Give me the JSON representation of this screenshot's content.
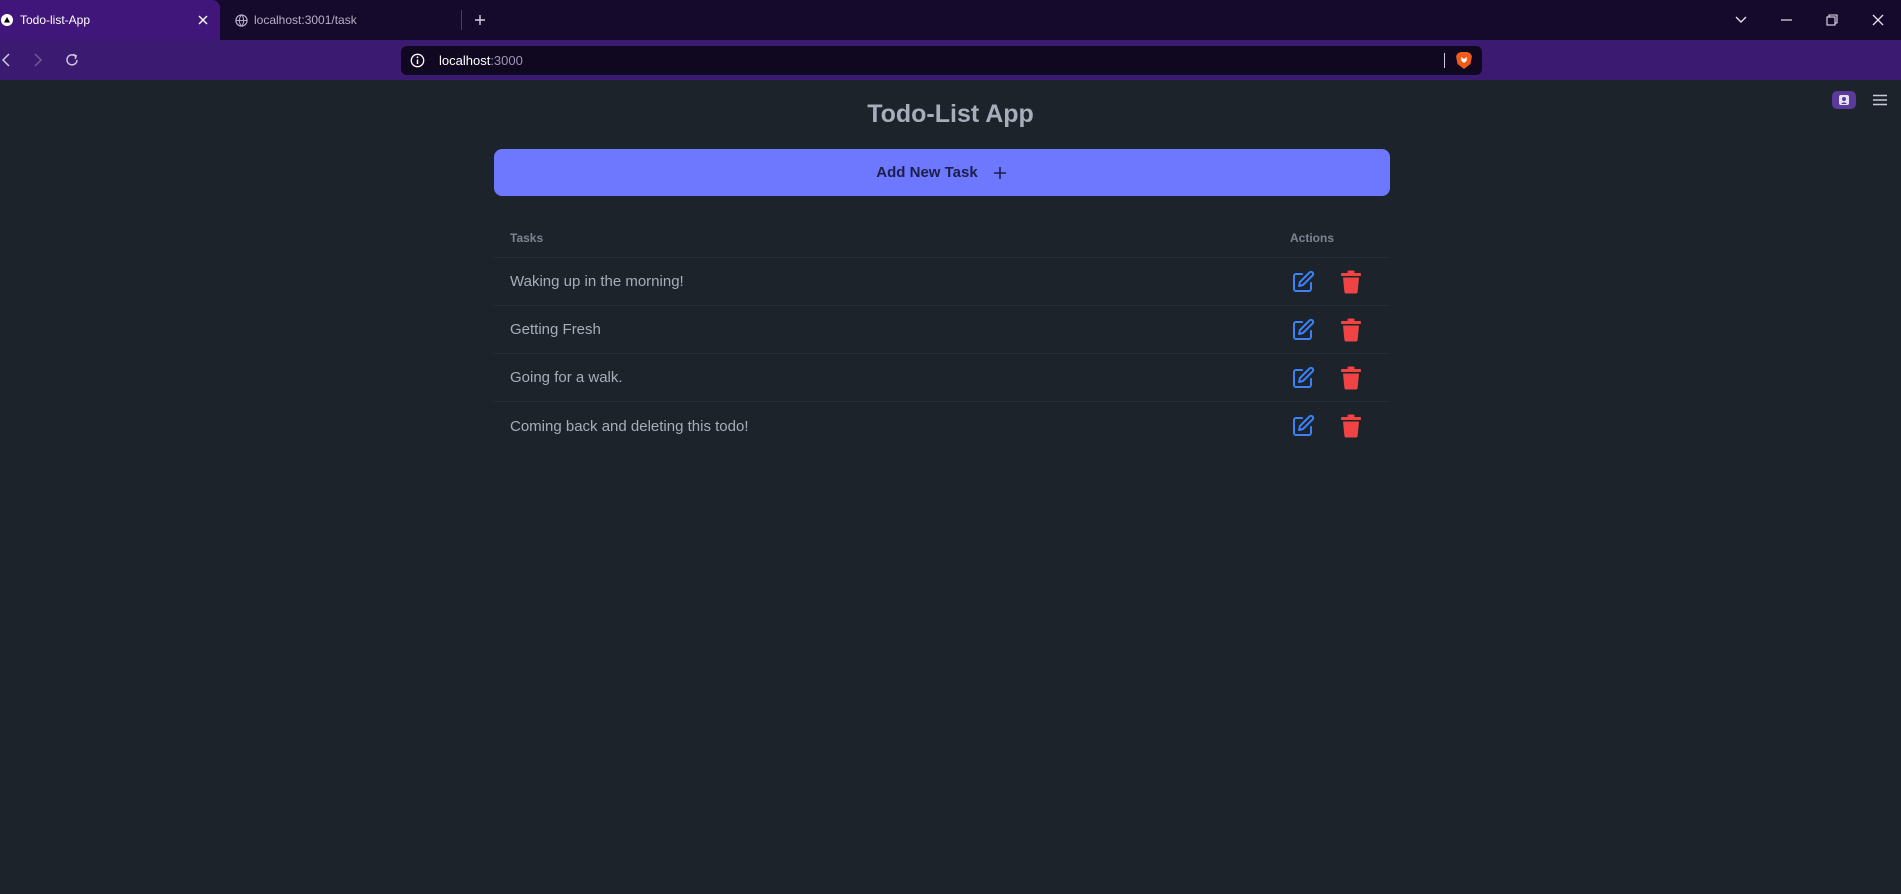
{
  "browser": {
    "tabs": [
      {
        "title": "Todo-list-App",
        "active": true,
        "favicon": "triangle-icon"
      },
      {
        "title": "localhost:3001/task",
        "active": false,
        "favicon": "globe-icon"
      }
    ],
    "url": {
      "host": "localhost",
      "port": ":3000"
    }
  },
  "app": {
    "title": "Todo-List App",
    "add_button_label": "Add New Task",
    "table": {
      "header_tasks": "Tasks",
      "header_actions": "Actions",
      "rows": [
        {
          "task": "Waking up in the morning!"
        },
        {
          "task": "Getting Fresh"
        },
        {
          "task": "Going for a walk."
        },
        {
          "task": "Coming back and deleting this todo!"
        }
      ]
    }
  },
  "colors": {
    "background": "#1d232a",
    "primary": "#6e78ff",
    "edit": "#3b82f6",
    "delete": "#ef4444",
    "tab_active": "#40167a",
    "toolbar": "#3b1a72"
  }
}
